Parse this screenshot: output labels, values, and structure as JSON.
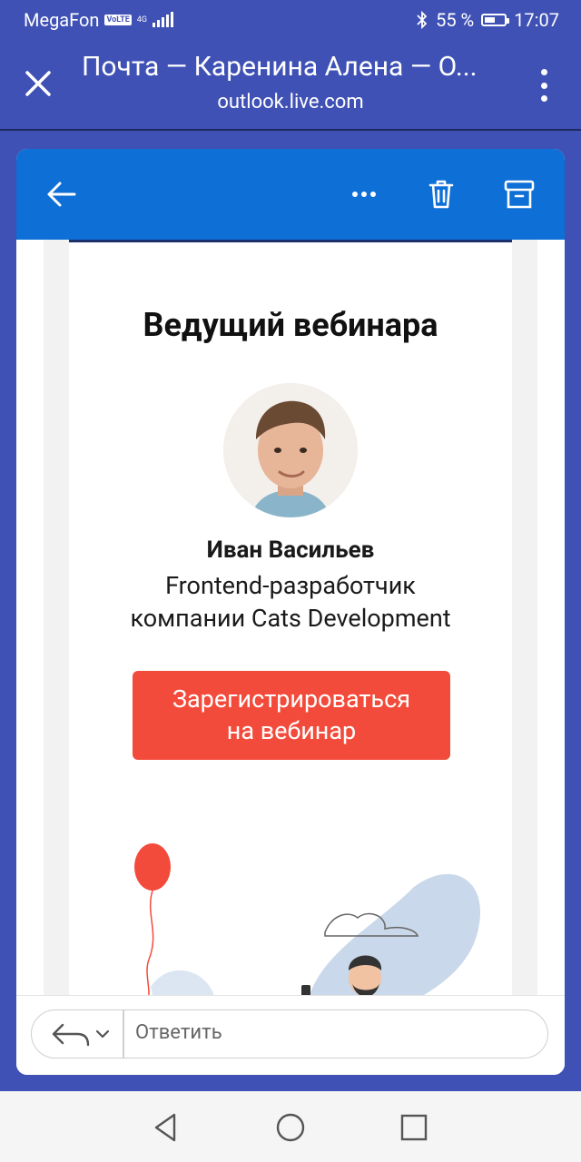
{
  "status_bar": {
    "carrier": "MegaFon",
    "volte": "VoLTE",
    "network": "4G",
    "battery_percent": "55 %",
    "battery_level": 0.55,
    "time": "17:07"
  },
  "browser": {
    "title": "Почта — Каренина Алена — О...",
    "url": "outlook.live.com"
  },
  "email": {
    "heading": "Ведущий вебинара",
    "speaker_name": "Иван Васильев",
    "speaker_role_line1": "Frontend-разработчик",
    "speaker_role_line2": "компании Cats Development",
    "cta_line1": "Зарегистрироваться",
    "cta_line2": "на вебинар"
  },
  "reply": {
    "placeholder": "Ответить"
  },
  "colors": {
    "statusbar_bg": "#3f51b5",
    "toolbar_bg": "#0e6fd6",
    "cta_bg": "#f34b3b"
  }
}
